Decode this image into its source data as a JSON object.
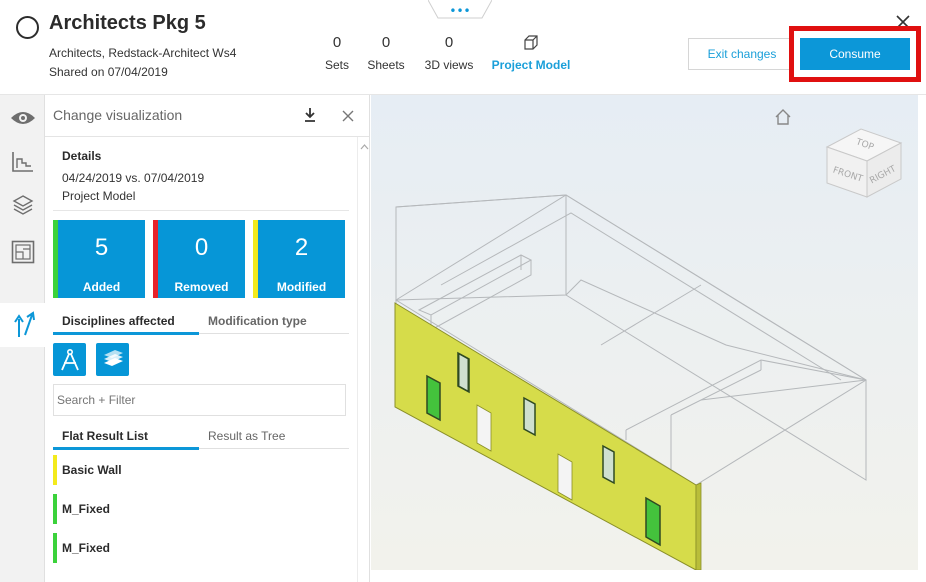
{
  "header": {
    "title": "Architects Pkg 5",
    "subtitle": "Architects, Redstack-Architect Ws4",
    "shared": "Shared on 07/04/2019",
    "tab_dots": "•••",
    "stats": {
      "sets": {
        "num": "0",
        "label": "Sets"
      },
      "sheets": {
        "num": "0",
        "label": "Sheets"
      },
      "views3d": {
        "num": "0",
        "label": "3D views"
      },
      "model": {
        "label": "Project Model",
        "icon": "cube-icon"
      }
    },
    "exit_label": "Exit changes",
    "consume_label": "Consume",
    "accent_color": "#0c97d8",
    "highlight_color": "#e01010"
  },
  "rail": {
    "items": [
      "eye-icon",
      "chart-icon",
      "layers-icon",
      "sheet-icon",
      "compare-icon"
    ]
  },
  "panel": {
    "title": "Change visualization",
    "details_heading": "Details",
    "date_range": "04/24/2019 vs. 07/04/2019",
    "model": "Project Model",
    "tiles": {
      "added": {
        "num": "5",
        "label": "Added",
        "color": "#3bd23b"
      },
      "removed": {
        "num": "0",
        "label": "Removed",
        "color": "#e8222a"
      },
      "modified": {
        "num": "2",
        "label": "Modified",
        "color": "#f3ea1c"
      }
    },
    "tabs1": {
      "selected": "Disciplines affected",
      "other": "Modification type"
    },
    "disciplines": [
      "drafting-compass-icon",
      "layers-stack-icon"
    ],
    "search_placeholder": "Search + Filter",
    "tabs2": {
      "selected": "Flat Result List",
      "other": "Result as Tree"
    },
    "results": [
      {
        "label": "Basic Wall",
        "color": "#f3ea1c"
      },
      {
        "label": "M_Fixed",
        "color": "#3bd23b"
      },
      {
        "label": "M_Fixed",
        "color": "#3bd23b"
      }
    ]
  },
  "viewport": {
    "viewcube": {
      "top": "TOP",
      "front": "FRONT",
      "right": "RIGHT"
    }
  }
}
